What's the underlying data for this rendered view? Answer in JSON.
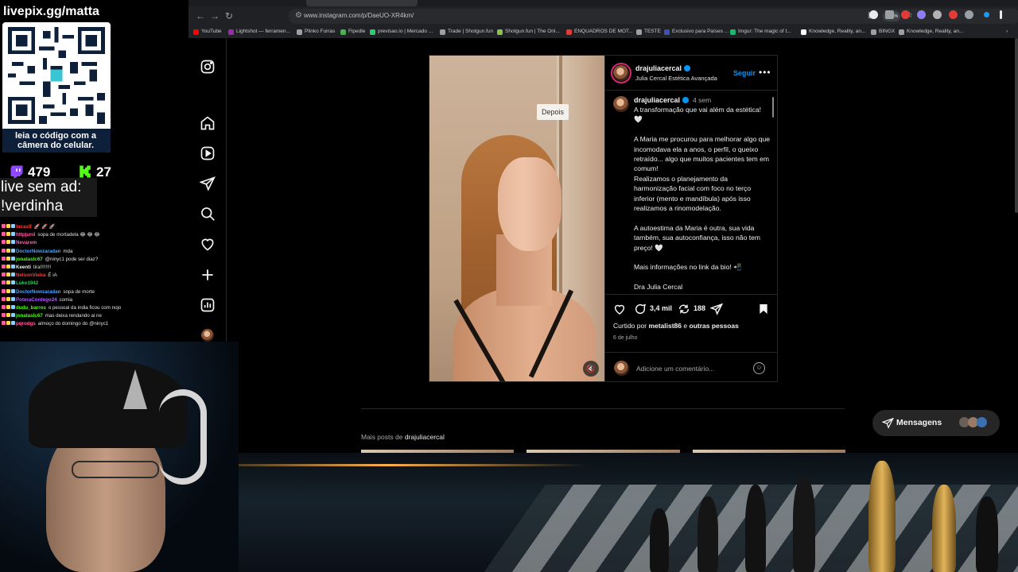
{
  "browser": {
    "url": "www.instagram.com/p/DaeUO-XR4km/",
    "zoom": "120%",
    "bookmarks": [
      {
        "label": "YouTube",
        "color": "#ff0000"
      },
      {
        "label": "Lightshot — ferramen...",
        "color": "#9c27b0"
      },
      {
        "label": "Plinko Furras",
        "color": "#9aa0a6"
      },
      {
        "label": "Fipedle",
        "color": "#4caf50"
      },
      {
        "label": "previsao.io | Mercado ...",
        "color": "#2ecc71"
      },
      {
        "label": "Trade | Shotgun.fun",
        "color": "#9aa0a6"
      },
      {
        "label": "Shotgun.fun | The Onl...",
        "color": "#8bc34a"
      },
      {
        "label": "ENQUADROS DE MOT...",
        "color": "#e53935"
      },
      {
        "label": "TESTE",
        "color": "#9aa0a6"
      },
      {
        "label": "Exclusivo para Países ...",
        "color": "#3f51b5"
      },
      {
        "label": "Imgur: The magic of t...",
        "color": "#1bb76e"
      },
      {
        "label": "Knowledge, Reality, an...",
        "color": "#ffffff"
      },
      {
        "label": "BINGX",
        "color": "#9aa0a6"
      },
      {
        "label": "Knowledge, Reality, an...",
        "color": "#9aa0a6"
      }
    ]
  },
  "post": {
    "author": "drajuliacercal",
    "author_subtitle": "Julia Cercal Estética Avançada",
    "follow_label": "Seguir",
    "more_label": "•••",
    "media_tag": "Depois",
    "caption_time": "4 sem",
    "caption_paragraphs": [
      "A transformação que vai além da estética! 🤍",
      "A Maria me procurou para melhorar algo que incomodava ela a anos, o perfil, o queixo retraído... algo que muitos pacientes tem em comum!\nRealizamos o planejamento da harmonização facial com foco no terço inferior (mento e mandíbula) após isso realizamos a rinomodelação.",
      "A autoestima da Maria é outra, sua vida também, sua autoconfiança, isso não tem preço! 🤍",
      "Mais informações no link da bio! 📲",
      "Dra Julia Cercal"
    ],
    "comments_count": "3,4 mil",
    "reposts_count": "188",
    "liked_by_prefix": "Curtido por",
    "liked_by_user": "metalist86",
    "liked_by_conj": "e",
    "liked_by_others": "outras pessoas",
    "date": "6 de julho",
    "comment_placeholder": "Adicione um comentário..."
  },
  "more_posts": {
    "prefix": "Mais posts de",
    "user": "drajuliacercal"
  },
  "messages": {
    "label": "Mensagens"
  },
  "overlay": {
    "qr_title": "livepix.gg/matta",
    "qr_caption": "leia o código com a câmera do celular.",
    "twitch_viewers": "479",
    "kick_viewers": "27",
    "noad_line1": "live sem ad:",
    "noad_line2": "!verdinha",
    "chat": [
      {
        "user": "lucaslf",
        "color": "#ff3b3b",
        "text": "🚀 🚀 🚀"
      },
      {
        "user": "httpjunii",
        "color": "#ff5fa2",
        "text": "sopa de mortadela 😂 😂 😂"
      },
      {
        "user": "Nevarem",
        "color": "#ff5fa2",
        "text": ""
      },
      {
        "user": "DoctorNowzaradan",
        "color": "#4aa3ff",
        "text": "mda"
      },
      {
        "user": "jonataslc67",
        "color": "#53fc18",
        "text": "@ninyc1 pode ser diaz?"
      },
      {
        "user": "Keenti",
        "color": "#f0f0f0",
        "text": "tira!!!!!!!!"
      },
      {
        "user": "NelsonVieira",
        "color": "#ff3b3b",
        "text": "É iA"
      },
      {
        "user": "Luke1942",
        "color": "#22cc55",
        "text": ""
      },
      {
        "user": "DoctorNowzaradan",
        "color": "#4aa3ff",
        "text": "sopa de morte"
      },
      {
        "user": "PoteraCordego24",
        "color": "#b05cff",
        "text": "comia"
      },
      {
        "user": "dudu_barros",
        "color": "#53fc18",
        "text": "o pessoal da india ficou com nojo"
      },
      {
        "user": "jonataslc67",
        "color": "#53fc18",
        "text": "mas deixa rendando ai ne"
      },
      {
        "user": "pqrodgs",
        "color": "#ff5fa2",
        "text": "almoço do domingo do @ninyc1"
      }
    ]
  }
}
